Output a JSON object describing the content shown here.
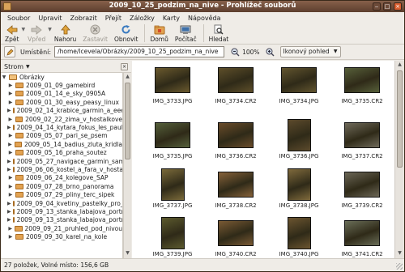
{
  "window": {
    "title": "2009_10_25_podzim_na_nive - Prohlížeč souborů",
    "accent": "#6e4c3a"
  },
  "menu": [
    "Soubor",
    "Upravit",
    "Zobrazit",
    "Přejít",
    "Záložky",
    "Karty",
    "Nápověda"
  ],
  "toolbar": {
    "back": "Zpět",
    "forward": "Vpřed",
    "up": "Nahoru",
    "stop": "Zastavit",
    "reload": "Obnovit",
    "home": "Domů",
    "computer": "Počítač",
    "search": "Hledat"
  },
  "location": {
    "label": "Umístění:",
    "path": "/home/lcevela/Obrázky/2009_10_25_podzim_na_nive",
    "zoom": "100%",
    "view": "Ikonový pohled"
  },
  "sidebar": {
    "title": "Strom",
    "root": "Obrázky",
    "items": [
      "2009_01_09_gamebird",
      "2009_01_14_e_sky_0905A",
      "2009_01_30_easy_peasy_linux",
      "2009_02_14_krabice_garmin_a_eee",
      "2009_02_22_zima_v_hostalkove",
      "2009_04_14_kytara_fokus_les_paul",
      "2009_05_07_pari_se_psem",
      "2009_05_14_badius_zluta_kridla",
      "2009_05_16_praha_soutez",
      "2009_05_27_navigace_garmin_samo",
      "2009_06_06_kostel_a_fara_v_hostal",
      "2009_06_24_kolegove_SAP",
      "2009_07_28_brno_panorama",
      "2009_07_29_pliny_terc_sipek",
      "2009_09_04_kvetiny_pastelky_pro_t",
      "2009_09_13_stanka_labajova_portre",
      "2009_09_13_stanka_labajova_portre",
      "2009_09_21_pruhled_pod_nivou",
      "2009_09_30_karel_na_kole"
    ]
  },
  "files": [
    {
      "name": "IMG_3733.JPG",
      "orient": "landscape",
      "tone": "#6b5a2e"
    },
    {
      "name": "IMG_3734.CR2",
      "orient": "landscape",
      "tone": "#5e4f2a"
    },
    {
      "name": "IMG_3734.JPG",
      "orient": "landscape",
      "tone": "#62552f"
    },
    {
      "name": "IMG_3735.CR2",
      "orient": "landscape",
      "tone": "#57603a"
    },
    {
      "name": "IMG_3735.JPG",
      "orient": "landscape",
      "tone": "#55603b"
    },
    {
      "name": "IMG_3736.CR2",
      "orient": "landscape",
      "tone": "#6a4c2a"
    },
    {
      "name": "IMG_3736.JPG",
      "orient": "portrait",
      "tone": "#5c4a2c"
    },
    {
      "name": "IMG_3737.CR2",
      "orient": "landscape",
      "tone": "#6f6a5a"
    },
    {
      "name": "IMG_3737.JPG",
      "orient": "portrait",
      "tone": "#7a6a3a"
    },
    {
      "name": "IMG_3738.CR2",
      "orient": "landscape",
      "tone": "#86623a"
    },
    {
      "name": "IMG_3738.JPG",
      "orient": "portrait",
      "tone": "#7f6a3c"
    },
    {
      "name": "IMG_3739.CR2",
      "orient": "landscape",
      "tone": "#6b6656"
    },
    {
      "name": "IMG_3739.JPG",
      "orient": "portrait",
      "tone": "#5c5a2e"
    },
    {
      "name": "IMG_3740.CR2",
      "orient": "landscape",
      "tone": "#7a5a34"
    },
    {
      "name": "IMG_3740.JPG",
      "orient": "portrait",
      "tone": "#6c5530"
    },
    {
      "name": "IMG_3741.CR2",
      "orient": "landscape",
      "tone": "#6a6e58"
    }
  ],
  "status": "27 položek, Volné místo: 156,6 GB"
}
